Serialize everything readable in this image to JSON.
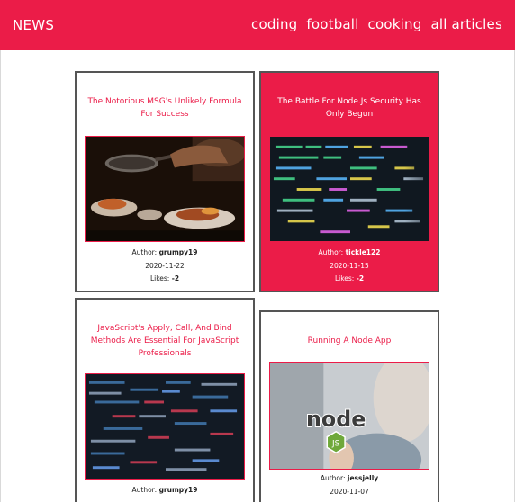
{
  "nav": {
    "brand": "NEWS",
    "links": [
      "coding",
      "football",
      "cooking",
      "all articles"
    ]
  },
  "articles": [
    {
      "title": "The Notorious MSG's Unlikely Formula For Success",
      "image": "cooking-pan-image",
      "author_label": "Author:",
      "author": "grumpy19",
      "date": "2020-11-22",
      "likes_label": "Likes:",
      "likes": "-2"
    },
    {
      "title": "The Battle For Node.Js Security Has Only Begun",
      "image": "code-screen-image",
      "author_label": "Author:",
      "author": "tickle122",
      "date": "2020-11-15",
      "likes_label": "Likes:",
      "likes": "-2"
    },
    {
      "title": "JavaScript's Apply, Call, And Bind Methods Are Essential For JavaScript Professionals",
      "image": "code-dark-image",
      "author_label": "Author:",
      "author": "grumpy19",
      "date": "",
      "likes_label": "",
      "likes": ""
    },
    {
      "title": "Running A Node App",
      "image": "node-logo-image",
      "author_label": "Author:",
      "author": "jessjelly",
      "date": "2020-11-07",
      "likes_label": "",
      "likes": ""
    }
  ],
  "colors": {
    "accent": "#eb1c48",
    "card_border": "#555555"
  }
}
